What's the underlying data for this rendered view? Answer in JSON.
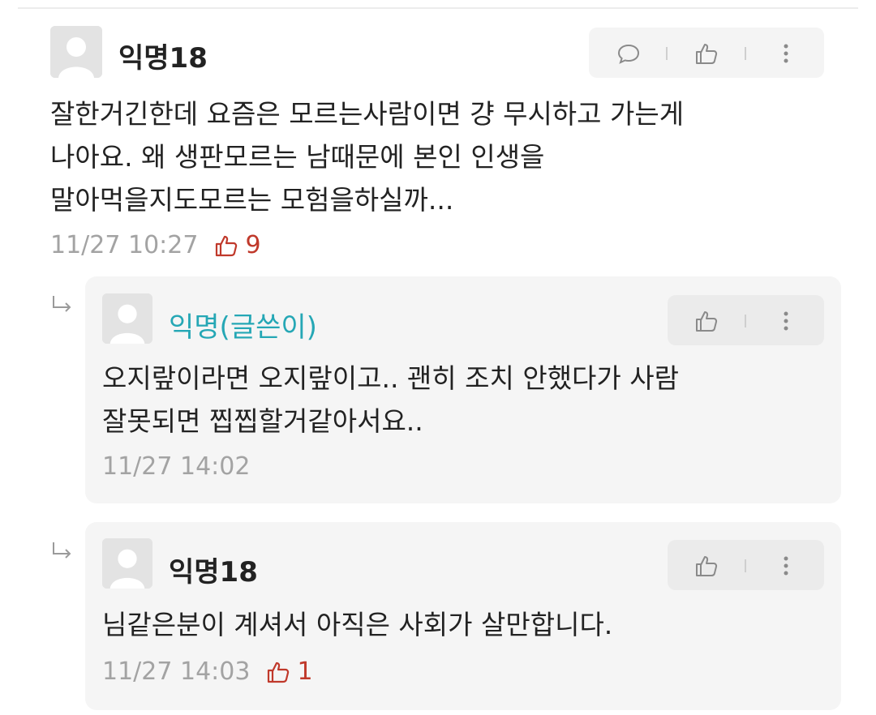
{
  "comments": [
    {
      "username": "익명18",
      "text": "잘한거긴한데 요즘은 모르는사람이면 걍 무시하고 가는게\n나아요. 왜 생판모르는 남때문에 본인 인생을\n말아먹을지도모르는 모험을하실까...",
      "timestamp": "11/27 10:27",
      "likes": "9",
      "actions": [
        "comment-icon",
        "thumbs-up-icon",
        "more-icon"
      ]
    }
  ],
  "replies": [
    {
      "username": "익명(글쓴이)",
      "is_author": true,
      "text": "오지랖이라면 오지랖이고.. 괜히 조치 안했다가 사람\n잘못되면 찝찝할거같아서요..",
      "timestamp": "11/27 14:02",
      "actions": [
        "thumbs-up-icon",
        "more-icon"
      ]
    },
    {
      "username": "익명18",
      "is_author": false,
      "text": "님같은분이 계셔서 아직은 사회가 살만합니다.",
      "timestamp": "11/27 14:03",
      "likes": "1",
      "actions": [
        "thumbs-up-icon",
        "more-icon"
      ]
    }
  ],
  "colors": {
    "author_name": "#25a7b5",
    "like_red": "#c0392b",
    "meta_gray": "#a3a3a3",
    "reply_bg": "#f5f5f5"
  }
}
